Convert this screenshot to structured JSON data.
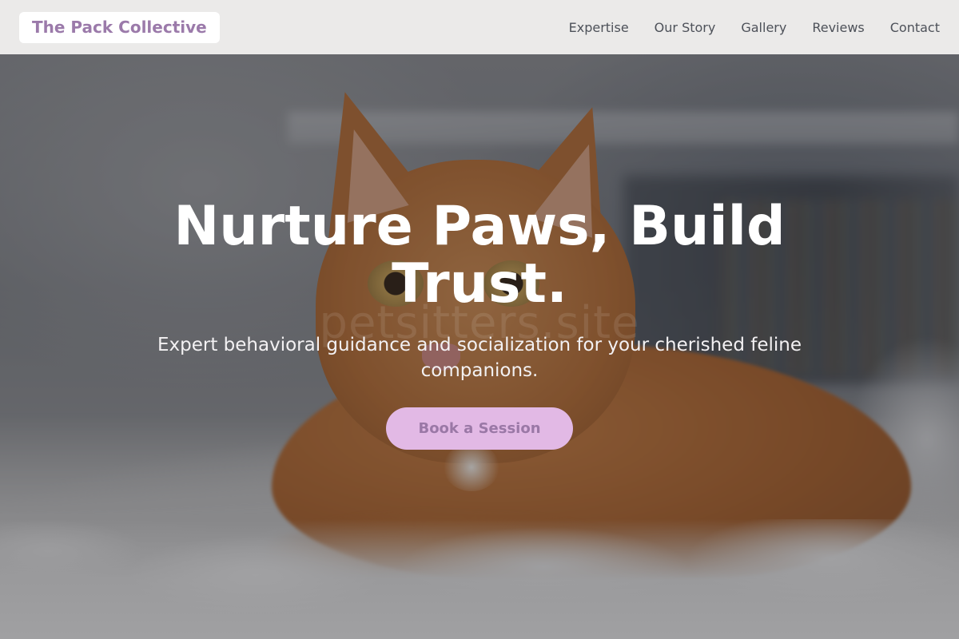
{
  "header": {
    "brand": "The Pack Collective",
    "nav": [
      {
        "label": "Expertise"
      },
      {
        "label": "Our Story"
      },
      {
        "label": "Gallery"
      },
      {
        "label": "Reviews"
      },
      {
        "label": "Contact"
      }
    ]
  },
  "hero": {
    "title": "Nurture Paws, Build Trust.",
    "watermark": "petsitters.site",
    "subtitle": "Expert behavioral guidance and socialization for your cherished feline companions.",
    "cta_label": "Book a Session",
    "background_image": "orange-tabby-kitten-on-fluffy-blanket"
  },
  "colors": {
    "brand_text": "#9b7aaa",
    "cta_background": "#e2b9e5",
    "cta_text": "#9a78a6",
    "nav_text": "#4d5159",
    "header_background": "#f0efee"
  }
}
